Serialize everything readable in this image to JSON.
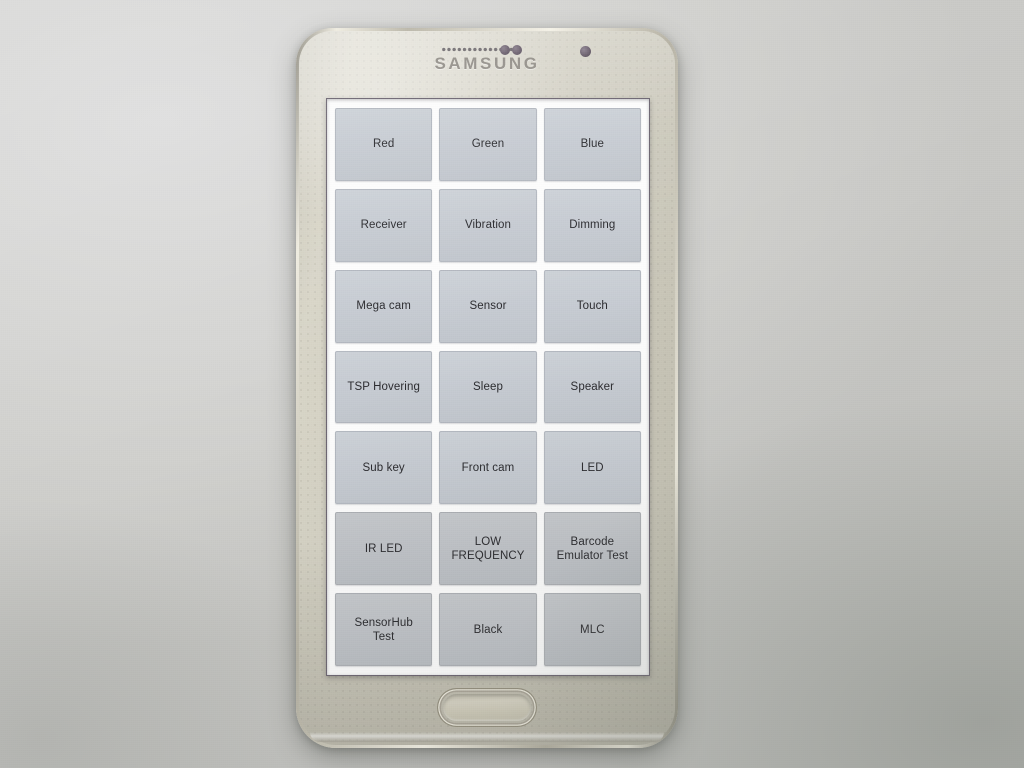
{
  "scene": {
    "background_color": "#d4d4d1",
    "shadow_color": "#7d8279"
  },
  "phone": {
    "brand_logo": "SAMSUNG",
    "body_color": "#d2cfc1",
    "bezel_trim_color": "#efece0",
    "hardware": {
      "earpiece": "earpiece-speaker-grille",
      "proximity_sensor": "proximity-sensor",
      "light_sensor": "ambient-light-sensor",
      "front_camera": "front-camera",
      "home_button": "home-button"
    }
  },
  "screen": {
    "background_color": "#fdfdfd",
    "border_color": "#6b6470",
    "app": {
      "tile_fill_color": "#c7ccd3",
      "tile_border_color": "#b3b8c0",
      "tile_text_color": "#2a2a2e",
      "columns": 3,
      "rows": 7,
      "tiles": [
        {
          "label": "Red"
        },
        {
          "label": "Green"
        },
        {
          "label": "Blue"
        },
        {
          "label": "Receiver"
        },
        {
          "label": "Vibration"
        },
        {
          "label": "Dimming"
        },
        {
          "label": "Mega cam"
        },
        {
          "label": "Sensor"
        },
        {
          "label": "Touch"
        },
        {
          "label": "TSP Hovering"
        },
        {
          "label": "Sleep"
        },
        {
          "label": "Speaker"
        },
        {
          "label": "Sub key"
        },
        {
          "label": "Front cam"
        },
        {
          "label": "LED"
        },
        {
          "label": "IR LED"
        },
        {
          "label": "LOW\nFREQUENCY"
        },
        {
          "label": "Barcode\nEmulator Test"
        },
        {
          "label": "SensorHub\nTest"
        },
        {
          "label": "Black"
        },
        {
          "label": "MLC"
        }
      ]
    }
  }
}
